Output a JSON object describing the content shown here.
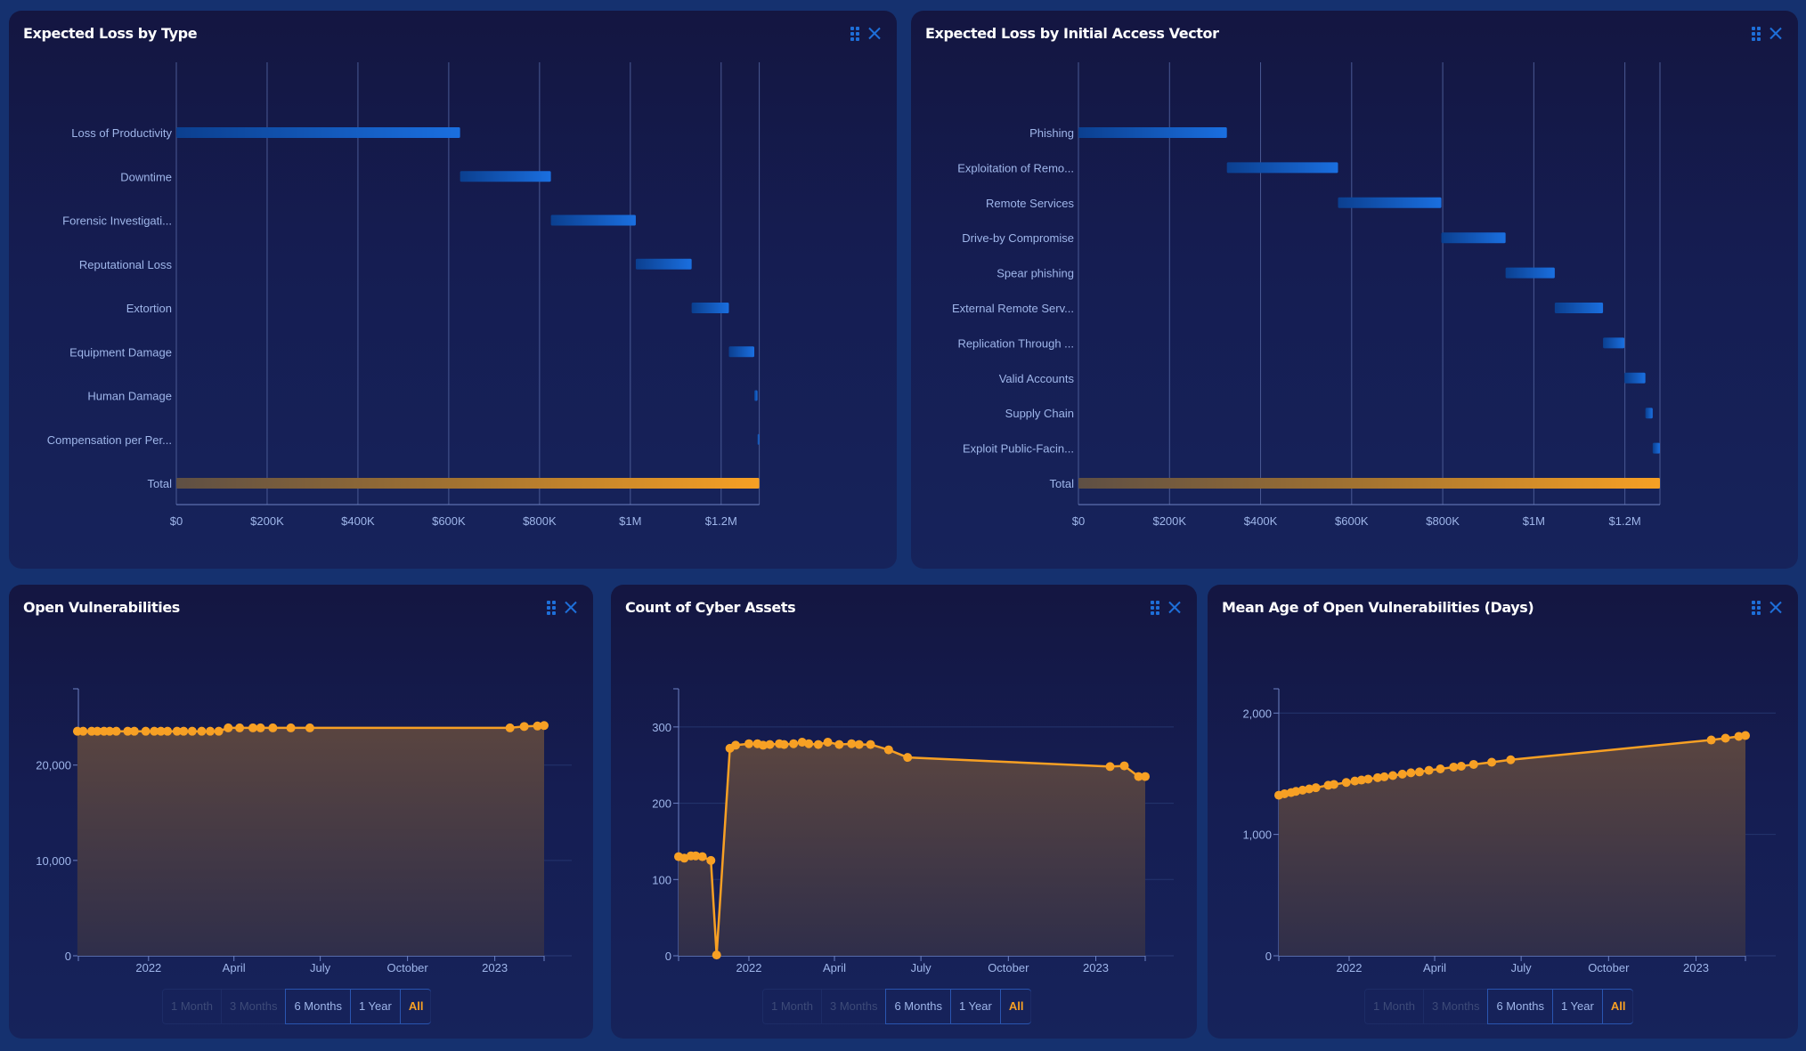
{
  "panels": {
    "loss_by_type": {
      "title": "Expected Loss by Type",
      "drag_icon": "drag-handle-icon",
      "close_icon": "close-icon"
    },
    "loss_by_vector": {
      "title": "Expected Loss by Initial Access Vector",
      "drag_icon": "drag-handle-icon",
      "close_icon": "close-icon"
    },
    "open_vulns": {
      "title": "Open Vulnerabilities",
      "range_buttons": [
        {
          "label": "1 Month",
          "state": "disabled"
        },
        {
          "label": "3 Months",
          "state": "disabled"
        },
        {
          "label": "6 Months",
          "state": "enabled"
        },
        {
          "label": "1 Year",
          "state": "enabled"
        },
        {
          "label": "All",
          "state": "active"
        }
      ]
    },
    "cyber_assets": {
      "title": "Count of Cyber Assets",
      "range_buttons": [
        {
          "label": "1 Month",
          "state": "disabled"
        },
        {
          "label": "3 Months",
          "state": "disabled"
        },
        {
          "label": "6 Months",
          "state": "enabled"
        },
        {
          "label": "1 Year",
          "state": "enabled"
        },
        {
          "label": "All",
          "state": "active"
        }
      ]
    },
    "mean_age": {
      "title": "Mean Age of Open Vulnerabilities (Days)",
      "range_buttons": [
        {
          "label": "1 Month",
          "state": "disabled"
        },
        {
          "label": "3 Months",
          "state": "disabled"
        },
        {
          "label": "6 Months",
          "state": "enabled"
        },
        {
          "label": "1 Year",
          "state": "enabled"
        },
        {
          "label": "All",
          "state": "active"
        }
      ]
    }
  },
  "colors": {
    "bar_blue": "#1a6fe0",
    "bar_blue_dark": "#0b3f8f",
    "total_orange": "#f7a024",
    "line_orange": "#f7a024",
    "axis": "#6d82c4",
    "tick_label": "#9fb6ea",
    "grid": "#24356e"
  },
  "chart_data": [
    {
      "id": "loss_by_type",
      "type": "bar",
      "subtype": "waterfall-horizontal",
      "title": "Expected Loss by Type",
      "categories": [
        "Loss of Productivity",
        "Downtime",
        "Forensic Investigati...",
        "Reputational Loss",
        "Extortion",
        "Equipment Damage",
        "Human Damage",
        "Compensation per Per...",
        "Total"
      ],
      "values": [
        625000,
        200000,
        187000,
        123000,
        82000,
        56000,
        7000,
        4000,
        1284000
      ],
      "xlim": [
        0,
        1284000
      ],
      "xticks": [
        0,
        200000,
        400000,
        600000,
        800000,
        1000000,
        1200000
      ],
      "xtick_labels": [
        "$0",
        "$200K",
        "$400K",
        "$600K",
        "$800K",
        "$1M",
        "$1.2M"
      ],
      "xlabel": "",
      "ylabel": "",
      "grid": "vertical"
    },
    {
      "id": "loss_by_vector",
      "type": "bar",
      "subtype": "waterfall-horizontal",
      "title": "Expected Loss by Initial Access Vector",
      "categories": [
        "Phishing",
        "Exploitation of Remo...",
        "Remote Services",
        "Drive-by Compromise",
        "Spear phishing",
        "External Remote Serv...",
        "Replication Through ...",
        "Valid Accounts",
        "Supply Chain",
        "Exploit Public-Facin...",
        "Total"
      ],
      "values": [
        326000,
        244000,
        227000,
        141000,
        108000,
        106000,
        47000,
        46000,
        16000,
        16000,
        1277000
      ],
      "xlim": [
        0,
        1277000
      ],
      "xticks": [
        0,
        200000,
        400000,
        600000,
        800000,
        1000000,
        1200000
      ],
      "xtick_labels": [
        "$0",
        "$200K",
        "$400K",
        "$600K",
        "$800K",
        "$1M",
        "$1.2M"
      ],
      "xlabel": "",
      "ylabel": "",
      "grid": "vertical"
    },
    {
      "id": "open_vulns",
      "type": "area",
      "title": "Open Vulnerabilities",
      "x_range": [
        "2021-10-19",
        "2023-02-22"
      ],
      "ylim": [
        0,
        28000
      ],
      "yticks": [
        0,
        10000,
        20000
      ],
      "ytick_labels": [
        "0",
        "10,000",
        "20,000"
      ],
      "xticks": [
        "2022-01-01",
        "2022-04-01",
        "2022-07-01",
        "2022-10-01",
        "2023-01-01"
      ],
      "xtick_labels": [
        "2022",
        "April",
        "July",
        "October",
        "2023"
      ],
      "series": [
        {
          "name": "Open Vulnerabilities",
          "x": [
            "2021-10-18",
            "2021-10-24",
            "2021-11-02",
            "2021-11-08",
            "2021-11-15",
            "2021-11-21",
            "2021-11-28",
            "2021-12-10",
            "2021-12-17",
            "2021-12-29",
            "2022-01-07",
            "2022-01-14",
            "2022-01-21",
            "2022-01-31",
            "2022-02-07",
            "2022-02-16",
            "2022-02-26",
            "2022-03-07",
            "2022-03-16",
            "2022-03-26",
            "2022-04-07",
            "2022-04-21",
            "2022-04-29",
            "2022-05-12",
            "2022-05-31",
            "2022-06-20",
            "2023-01-17",
            "2023-02-01",
            "2023-02-15",
            "2023-02-22"
          ],
          "y": [
            23550,
            23550,
            23550,
            23550,
            23550,
            23550,
            23550,
            23550,
            23550,
            23550,
            23550,
            23550,
            23550,
            23550,
            23550,
            23550,
            23550,
            23550,
            23550,
            23900,
            23900,
            23900,
            23900,
            23900,
            23900,
            23900,
            23900,
            24050,
            24100,
            24150
          ]
        }
      ]
    },
    {
      "id": "cyber_assets",
      "type": "area",
      "title": "Count of Cyber Assets",
      "x_range": [
        "2021-10-19",
        "2023-02-22"
      ],
      "ylim": [
        0,
        350
      ],
      "yticks": [
        0,
        100,
        200,
        300
      ],
      "ytick_labels": [
        "0",
        "100",
        "200",
        "300"
      ],
      "xticks": [
        "2022-01-01",
        "2022-04-01",
        "2022-07-01",
        "2022-10-01",
        "2023-01-01"
      ],
      "xtick_labels": [
        "2022",
        "April",
        "July",
        "October",
        "2023"
      ],
      "series": [
        {
          "name": "Count of Cyber Assets",
          "x": [
            "2021-10-19",
            "2021-10-25",
            "2021-11-01",
            "2021-11-06",
            "2021-11-13",
            "2021-11-22",
            "2021-11-28",
            "2021-12-12",
            "2021-12-18",
            "2022-01-01",
            "2022-01-10",
            "2022-01-16",
            "2022-01-23",
            "2022-02-02",
            "2022-02-07",
            "2022-02-17",
            "2022-02-26",
            "2022-03-05",
            "2022-03-15",
            "2022-03-25",
            "2022-04-06",
            "2022-04-19",
            "2022-04-27",
            "2022-05-09",
            "2022-05-28",
            "2022-06-17",
            "2023-01-16",
            "2023-01-31",
            "2023-02-15",
            "2023-02-22"
          ],
          "y": [
            130,
            128,
            131,
            131,
            130,
            125,
            1,
            272,
            276,
            278,
            278,
            276,
            277,
            278,
            277,
            278,
            280,
            278,
            277,
            280,
            277,
            278,
            277,
            277,
            270,
            260,
            248,
            249,
            235,
            235
          ]
        }
      ]
    },
    {
      "id": "mean_age",
      "type": "area",
      "title": "Mean Age of Open Vulnerabilities (Days)",
      "x_range": [
        "2021-10-19",
        "2023-02-22"
      ],
      "ylim": [
        0,
        2200
      ],
      "yticks": [
        0,
        1000,
        2000
      ],
      "ytick_labels": [
        "0",
        "1,000",
        "2,000"
      ],
      "xticks": [
        "2022-01-01",
        "2022-04-01",
        "2022-07-01",
        "2022-10-01",
        "2023-01-01"
      ],
      "xtick_labels": [
        "2022",
        "April",
        "July",
        "October",
        "2023"
      ],
      "series": [
        {
          "name": "Mean Age (Days)",
          "x": [
            "2021-10-19",
            "2021-10-25",
            "2021-11-01",
            "2021-11-06",
            "2021-11-13",
            "2021-11-20",
            "2021-11-27",
            "2021-12-10",
            "2021-12-16",
            "2021-12-29",
            "2022-01-07",
            "2022-01-14",
            "2022-01-21",
            "2022-01-31",
            "2022-02-07",
            "2022-02-16",
            "2022-02-26",
            "2022-03-07",
            "2022-03-16",
            "2022-03-26",
            "2022-04-07",
            "2022-04-21",
            "2022-04-29",
            "2022-05-12",
            "2022-05-31",
            "2022-06-20",
            "2023-01-17",
            "2023-02-01",
            "2023-02-15",
            "2023-02-22"
          ],
          "y": [
            1323,
            1335,
            1345,
            1355,
            1365,
            1375,
            1385,
            1405,
            1412,
            1428,
            1440,
            1448,
            1456,
            1468,
            1475,
            1485,
            1497,
            1508,
            1515,
            1528,
            1540,
            1555,
            1562,
            1577,
            1595,
            1615,
            1778,
            1793,
            1808,
            1815
          ]
        }
      ]
    }
  ]
}
